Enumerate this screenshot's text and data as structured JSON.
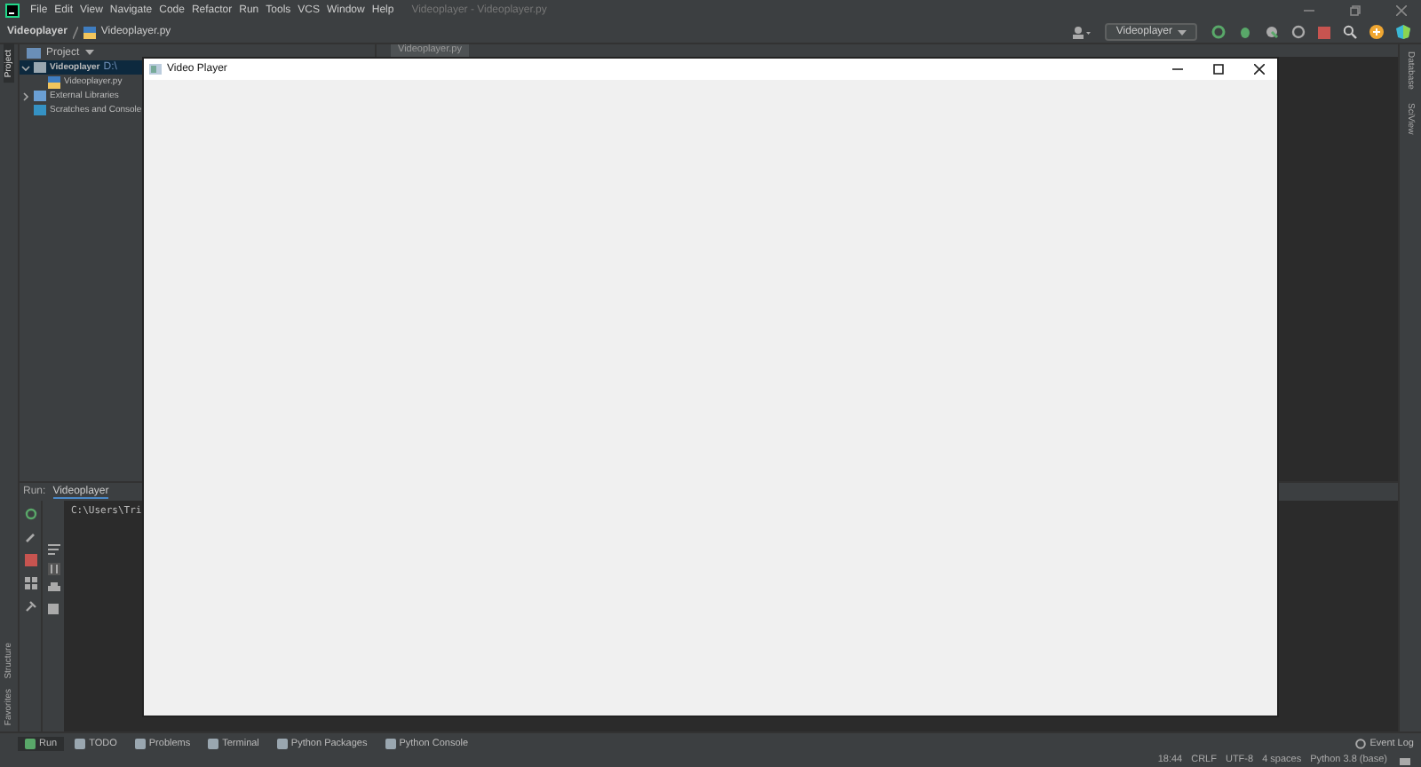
{
  "ide": {
    "menu": [
      "File",
      "Edit",
      "View",
      "Navigate",
      "Code",
      "Refactor",
      "Run",
      "Tools",
      "VCS",
      "Window",
      "Help"
    ],
    "title": "Videoplayer - Videoplayer.py"
  },
  "breadcrumb": [
    "Videoplayer",
    "Videoplayer.py"
  ],
  "run_config": "Videoplayer",
  "left_strip_top": [
    {
      "label": "Project",
      "selected": true
    }
  ],
  "left_strip_bottom": [
    {
      "label": "Structure",
      "selected": false
    },
    {
      "label": "Favorites",
      "selected": false
    }
  ],
  "project_panel": {
    "title": "Project",
    "tree": [
      {
        "label": "Videoplayer",
        "path": "D:\\",
        "kind": "folder",
        "expanded": true,
        "children": [
          {
            "label": "Videoplayer.py",
            "kind": "python"
          }
        ]
      },
      {
        "label": "External Libraries",
        "kind": "library",
        "expanded": false
      },
      {
        "label": "Scratches and Console",
        "kind": "scratch"
      }
    ]
  },
  "editor_tabs": [
    {
      "label": "Videoplayer.py",
      "selected": true
    }
  ],
  "right_strip": [
    "Database",
    "SciView"
  ],
  "run_panel": {
    "label": "Run:",
    "tab": "Videoplayer",
    "console": "C:\\Users\\Tri"
  },
  "tool_windows": [
    {
      "label": "Run",
      "kind": "run",
      "selected": true
    },
    {
      "label": "TODO",
      "kind": "list",
      "selected": false
    },
    {
      "label": "Problems",
      "kind": "info",
      "selected": false
    },
    {
      "label": "Terminal",
      "kind": "terminal",
      "selected": false
    },
    {
      "label": "Python Packages",
      "kind": "package",
      "selected": false
    },
    {
      "label": "Python Console",
      "kind": "console",
      "selected": false
    }
  ],
  "event_log": "Event Log",
  "status": [
    "18:44",
    "CRLF",
    "UTF-8",
    "4 spaces",
    "Python 3.8 (base)"
  ],
  "video_window": {
    "title": "Video Player"
  }
}
